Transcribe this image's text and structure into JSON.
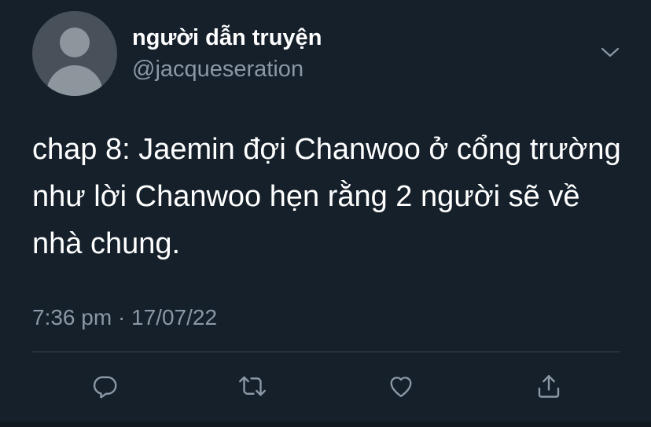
{
  "user": {
    "display_name": "người dẫn truyện",
    "handle": "@jacqueseration"
  },
  "tweet": {
    "text": "chap 8: Jaemin đợi Chanwoo ở cổng trường như lời Chanwoo hẹn rằng 2 người sẽ về nhà chung.",
    "timestamp": "7:36 pm · 17/07/22"
  },
  "actions": [
    "reply-icon",
    "retweet-icon",
    "like-icon",
    "share-icon"
  ],
  "colors": {
    "background": "#15202b",
    "primary_text": "#ffffff",
    "secondary_text": "#8b98a5",
    "divider": "#38444d"
  }
}
